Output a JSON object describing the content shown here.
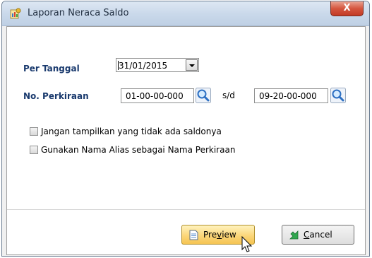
{
  "window": {
    "title": "Laporan Neraca Saldo",
    "close_label": "X",
    "icon": "report-chart-icon"
  },
  "form": {
    "per_tanggal_label": "Per Tanggal",
    "per_tanggal_value": "31/01/2015",
    "no_perkiraan_label": "No. Perkiraan",
    "account_from": "01-00-00-000",
    "to_label": "s/d",
    "account_to": "09-20-00-000",
    "checkbox_hide_zero": {
      "label": "Jangan tampilkan yang tidak ada saldonya",
      "checked": false
    },
    "checkbox_use_alias": {
      "label": "Gunakan Nama Alias sebagai Nama Perkiraan",
      "checked": false
    }
  },
  "buttons": {
    "preview_pre": "Pre",
    "preview_hot": "v",
    "preview_post": "iew",
    "cancel_hot": "C",
    "cancel_post": "ancel"
  },
  "colors": {
    "label_blue": "#1a3a6e",
    "preview_bg": "#fbd67a",
    "cancel_icon_green": "#2fa84f"
  }
}
